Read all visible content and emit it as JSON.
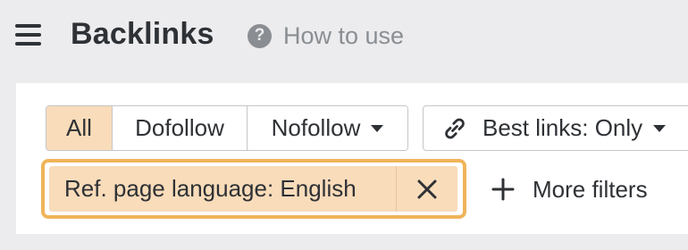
{
  "header": {
    "title": "Backlinks",
    "help_label": "How to use",
    "help_icon": "?"
  },
  "filters": {
    "link_type": {
      "options": [
        "All",
        "Dofollow",
        "Nofollow"
      ],
      "selected": "All"
    },
    "best_links": {
      "label": "Best links: Only"
    },
    "active_filter": {
      "label": "Ref. page language: English"
    },
    "more_filters": {
      "label": "More filters"
    }
  },
  "colors": {
    "accent_fill": "#f9dcba",
    "accent_outline": "#f0b45a",
    "text": "#2e3135",
    "muted": "#8a8e93"
  }
}
